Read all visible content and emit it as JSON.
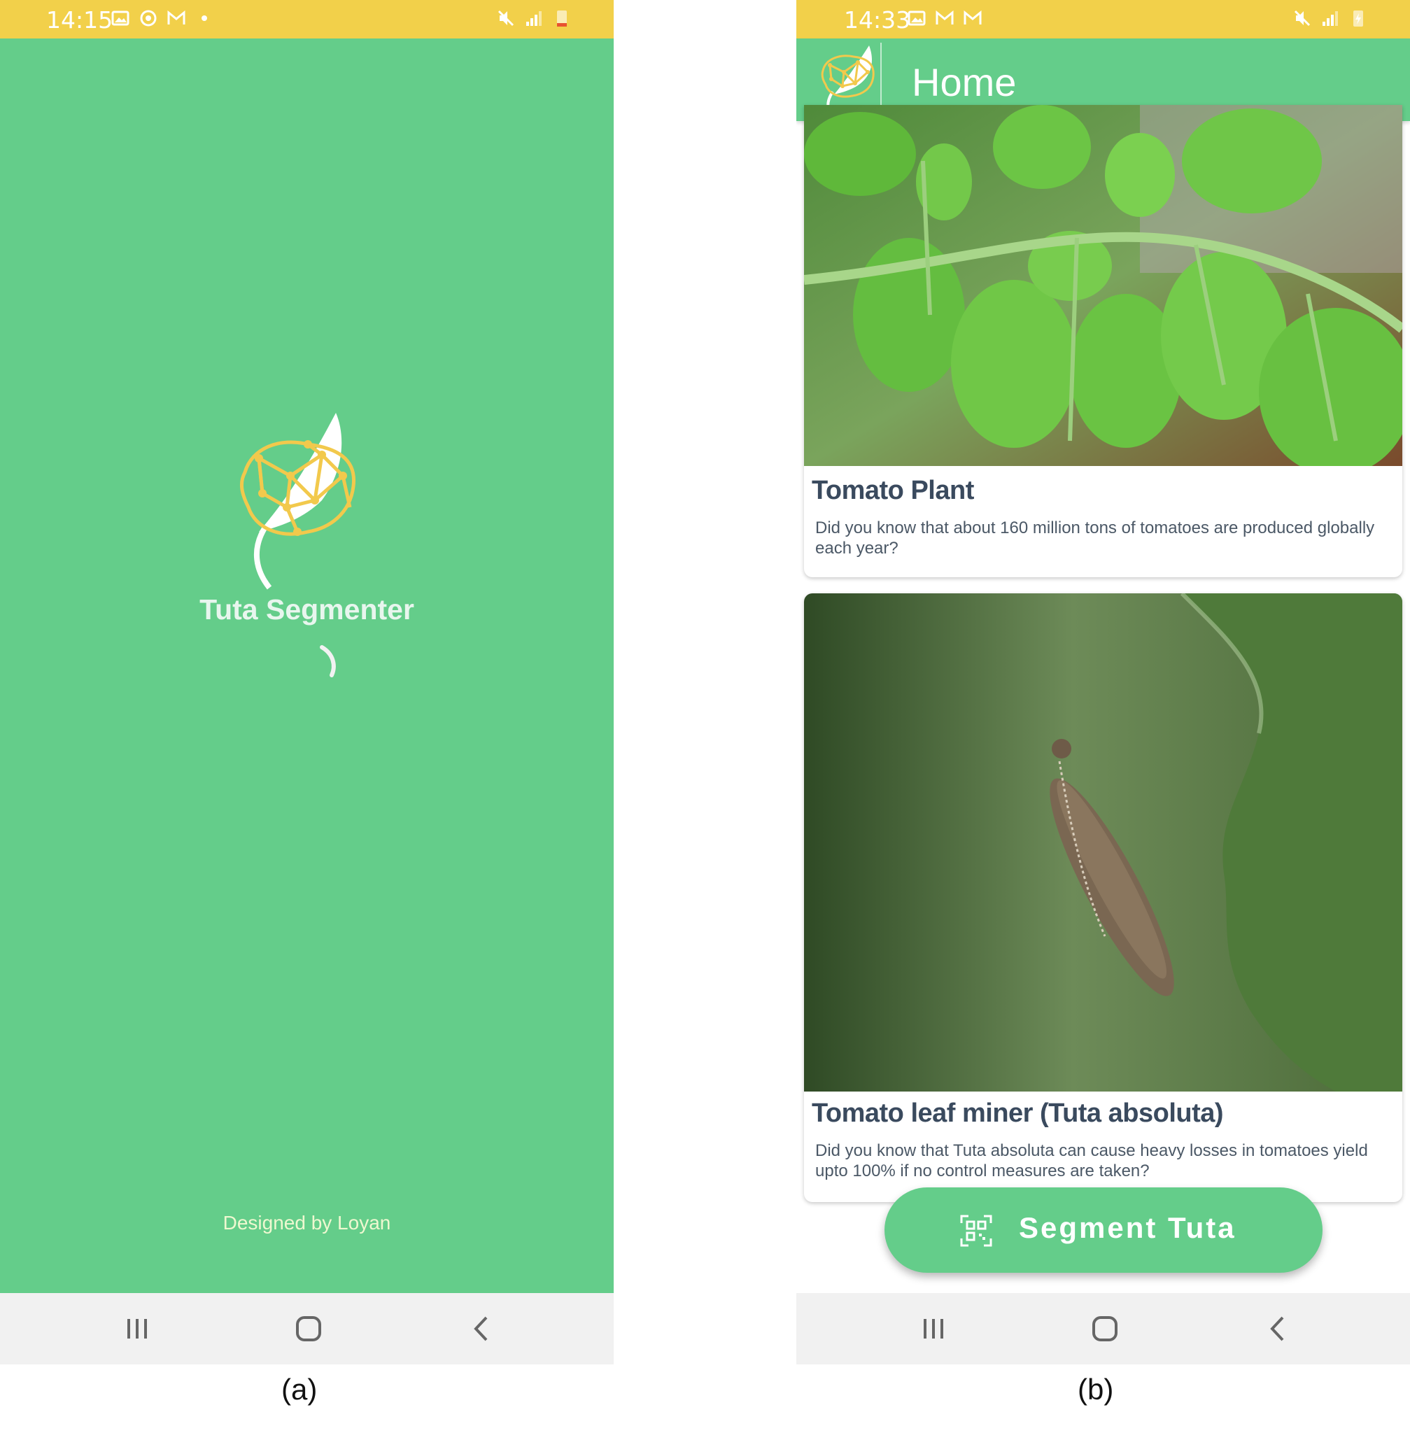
{
  "panel_a": {
    "status": {
      "time": "14:15",
      "left_icons": [
        "image-icon",
        "sync-icon",
        "gmail-icon",
        "dot-icon"
      ],
      "right_icons": [
        "mute-icon",
        "signal-icon",
        "battery-low-icon"
      ]
    },
    "splash": {
      "app_name": "Tuta Segmenter",
      "credit": "Designed by Loyan"
    },
    "caption": "(a)"
  },
  "panel_b": {
    "status": {
      "time": "14:33",
      "left_icons": [
        "image-icon",
        "gmail-icon",
        "gmail-icon"
      ],
      "right_icons": [
        "mute-icon",
        "signal-icon",
        "battery-charging-icon"
      ]
    },
    "appbar": {
      "title": "Home"
    },
    "cards": [
      {
        "title": "Tomato Plant",
        "description": "Did you know that about 160 million tons of tomatoes are produced globally each year?",
        "image": "tomato-leaves-photo"
      },
      {
        "title": "Tomato leaf miner (Tuta absoluta)",
        "description": "Did you know that Tuta absoluta can cause heavy losses in tomatoes yield upto 100% if no control measures are taken?",
        "image": "tuta-moth-photo"
      }
    ],
    "fab": {
      "label": "Segment Tuta",
      "icon": "qr-scan-icon"
    },
    "caption": "(b)"
  },
  "colors": {
    "primary_green": "#64cd8a",
    "status_yellow": "#f2d04a",
    "logo_yellow": "#f2c94c",
    "nav_gray": "#f1f1f1",
    "title_text": "#3a4a5e"
  }
}
